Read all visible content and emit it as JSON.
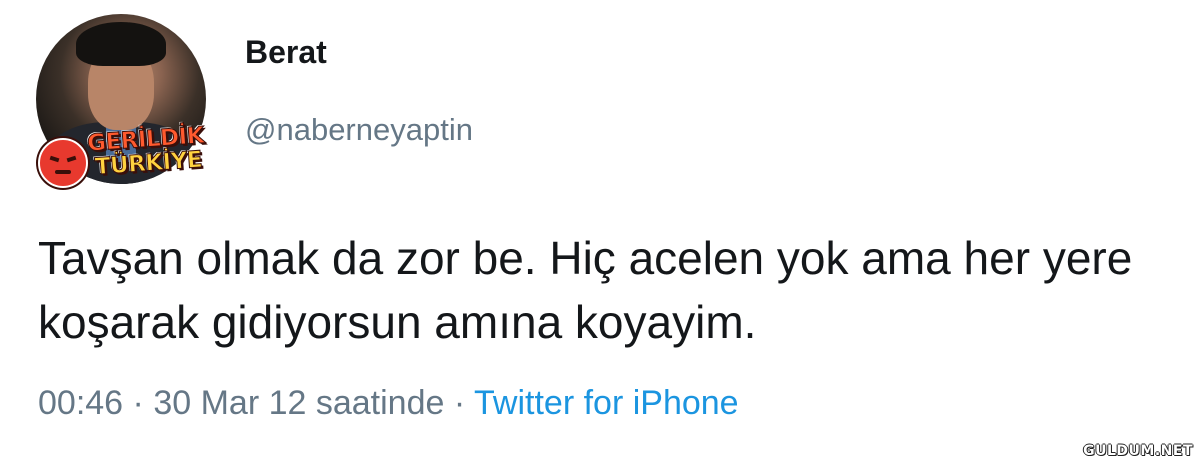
{
  "profile": {
    "display_name": "Berat",
    "handle": "@naberneyaptin",
    "badge_line1": "GERİLDİK",
    "badge_line2": "TÜRKİYE"
  },
  "tweet": {
    "text": "Tavşan olmak da zor be. Hiç acelen yok ama her yere koşarak gidiyorsun amına koyayim.",
    "time": "00:46",
    "date": "30 Mar 12 saatinde",
    "separator": "·",
    "source": "Twitter for iPhone"
  },
  "watermark": "GULDUM.NET",
  "colors": {
    "text": "#14171a",
    "secondary": "#657786",
    "link": "#1b95e0"
  }
}
